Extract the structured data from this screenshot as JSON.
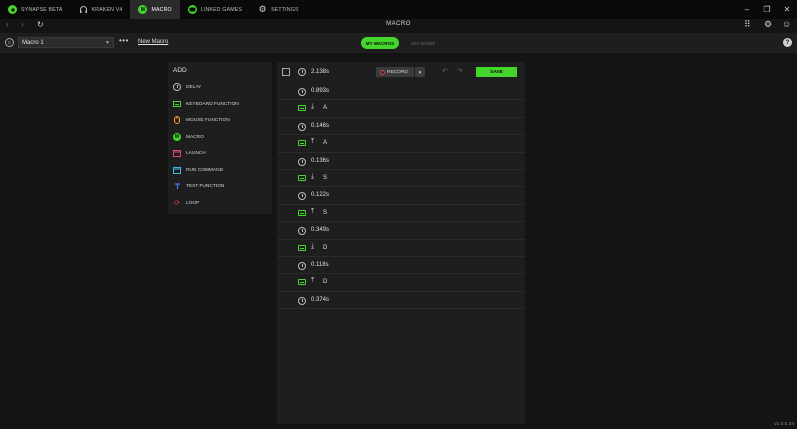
{
  "tabs": [
    {
      "label": "SYNAPSE BETA",
      "icon": "razer-icon",
      "active": false
    },
    {
      "label": "KRAKEN V4",
      "icon": "headset-icon",
      "active": false
    },
    {
      "label": "MACRO",
      "icon": "macro-icon",
      "active": true
    },
    {
      "label": "LINKED GAMES",
      "icon": "gamepad-icon",
      "active": false
    },
    {
      "label": "SETTINGS",
      "icon": "gear-icon",
      "active": false
    }
  ],
  "window": {
    "title": "MACRO"
  },
  "toolbar": {
    "selected_macro": "Macro 1",
    "new_macro": "New Macro",
    "tab_my_macros": "MY MACROS",
    "tab_key_binds": "KEY BINDS"
  },
  "add_panel": {
    "heading": "ADD",
    "items": [
      {
        "label": "DELAY",
        "icon": "clock-icon"
      },
      {
        "label": "KEYBOARD FUNCTION",
        "icon": "keyboard-icon"
      },
      {
        "label": "MOUSE FUNCTION",
        "icon": "mouse-icon"
      },
      {
        "label": "MACRO",
        "icon": "macro-icon"
      },
      {
        "label": "LAUNCH",
        "icon": "launch-icon"
      },
      {
        "label": "RUN COMMAND",
        "icon": "terminal-icon"
      },
      {
        "label": "TEXT FUNCTION",
        "icon": "text-icon"
      },
      {
        "label": "LOOP",
        "icon": "loop-icon"
      }
    ]
  },
  "sequence": {
    "total_time": "2.138s",
    "record_label": "RECORD",
    "save_label": "SAVE",
    "rows": [
      {
        "type": "delay",
        "value": "0.893s"
      },
      {
        "type": "key",
        "direction": "down",
        "value": "A"
      },
      {
        "type": "delay",
        "value": "0.146s"
      },
      {
        "type": "key",
        "direction": "up",
        "value": "A"
      },
      {
        "type": "delay",
        "value": "0.136s"
      },
      {
        "type": "key",
        "direction": "down",
        "value": "S"
      },
      {
        "type": "delay",
        "value": "0.122s"
      },
      {
        "type": "key",
        "direction": "up",
        "value": "S"
      },
      {
        "type": "delay",
        "value": "0.349s"
      },
      {
        "type": "key",
        "direction": "down",
        "value": "D"
      },
      {
        "type": "delay",
        "value": "0.118s"
      },
      {
        "type": "key",
        "direction": "up",
        "value": "D"
      },
      {
        "type": "delay",
        "value": "0.374s"
      }
    ]
  },
  "footer": {
    "version": "v1.0.0.34"
  },
  "colors": {
    "accent": "#44d62c",
    "record": "#e14141"
  }
}
